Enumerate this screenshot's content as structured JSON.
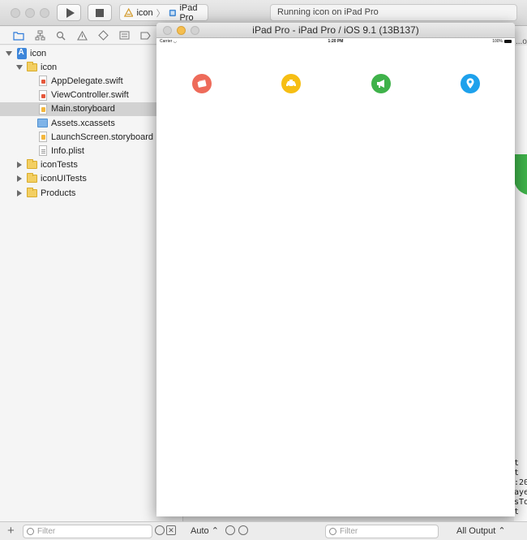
{
  "toolbar": {
    "scheme_target": "icon",
    "scheme_device": "iPad Pro",
    "activity_status": "Running icon on iPad Pro"
  },
  "navigator": {
    "tree": [
      {
        "label": "icon",
        "kind": "project",
        "depth": 0,
        "disclosure": "open"
      },
      {
        "label": "icon",
        "kind": "folder",
        "depth": 1,
        "disclosure": "open"
      },
      {
        "label": "AppDelegate.swift",
        "kind": "swift",
        "depth": 2
      },
      {
        "label": "ViewController.swift",
        "kind": "swift",
        "depth": 2
      },
      {
        "label": "Main.storyboard",
        "kind": "storyboard",
        "depth": 2,
        "selected": true
      },
      {
        "label": "Assets.xcassets",
        "kind": "assets",
        "depth": 2
      },
      {
        "label": "LaunchScreen.storyboard",
        "kind": "storyboard",
        "depth": 2
      },
      {
        "label": "Info.plist",
        "kind": "plist",
        "depth": 2
      },
      {
        "label": "iconTests",
        "kind": "folder",
        "depth": 1,
        "disclosure": "closed"
      },
      {
        "label": "iconUITests",
        "kind": "folder",
        "depth": 1,
        "disclosure": "closed"
      },
      {
        "label": "Products",
        "kind": "folder",
        "depth": 1,
        "disclosure": "closed"
      }
    ]
  },
  "simulator": {
    "title": "iPad Pro - iPad Pro / iOS 9.1 (13B137)",
    "status_bar": {
      "carrier": "Carrier",
      "time": "1:20 PM",
      "battery": "100%"
    },
    "icons": [
      {
        "name": "ticket-icon",
        "color": "#ee6b5a"
      },
      {
        "name": "taxi-icon",
        "color": "#f6be14"
      },
      {
        "name": "megaphone-icon",
        "color": "#3fb24a"
      },
      {
        "name": "location-pin-icon",
        "color": "#1ea1ec"
      }
    ]
  },
  "bottom_bar": {
    "navigator_filter_placeholder": "Filter",
    "debug_scope": "Auto",
    "debug_filter_placeholder": "Filter",
    "console_scope": "All Output"
  },
  "background": {
    "breadcrumb_fragment": "...ol",
    "console_fragments": [
      "t",
      "t",
      ":20",
      "aye",
      "sTo",
      "t"
    ]
  },
  "colors": {
    "selection": "#d2d2d2",
    "accent": "#2f7bd9"
  }
}
